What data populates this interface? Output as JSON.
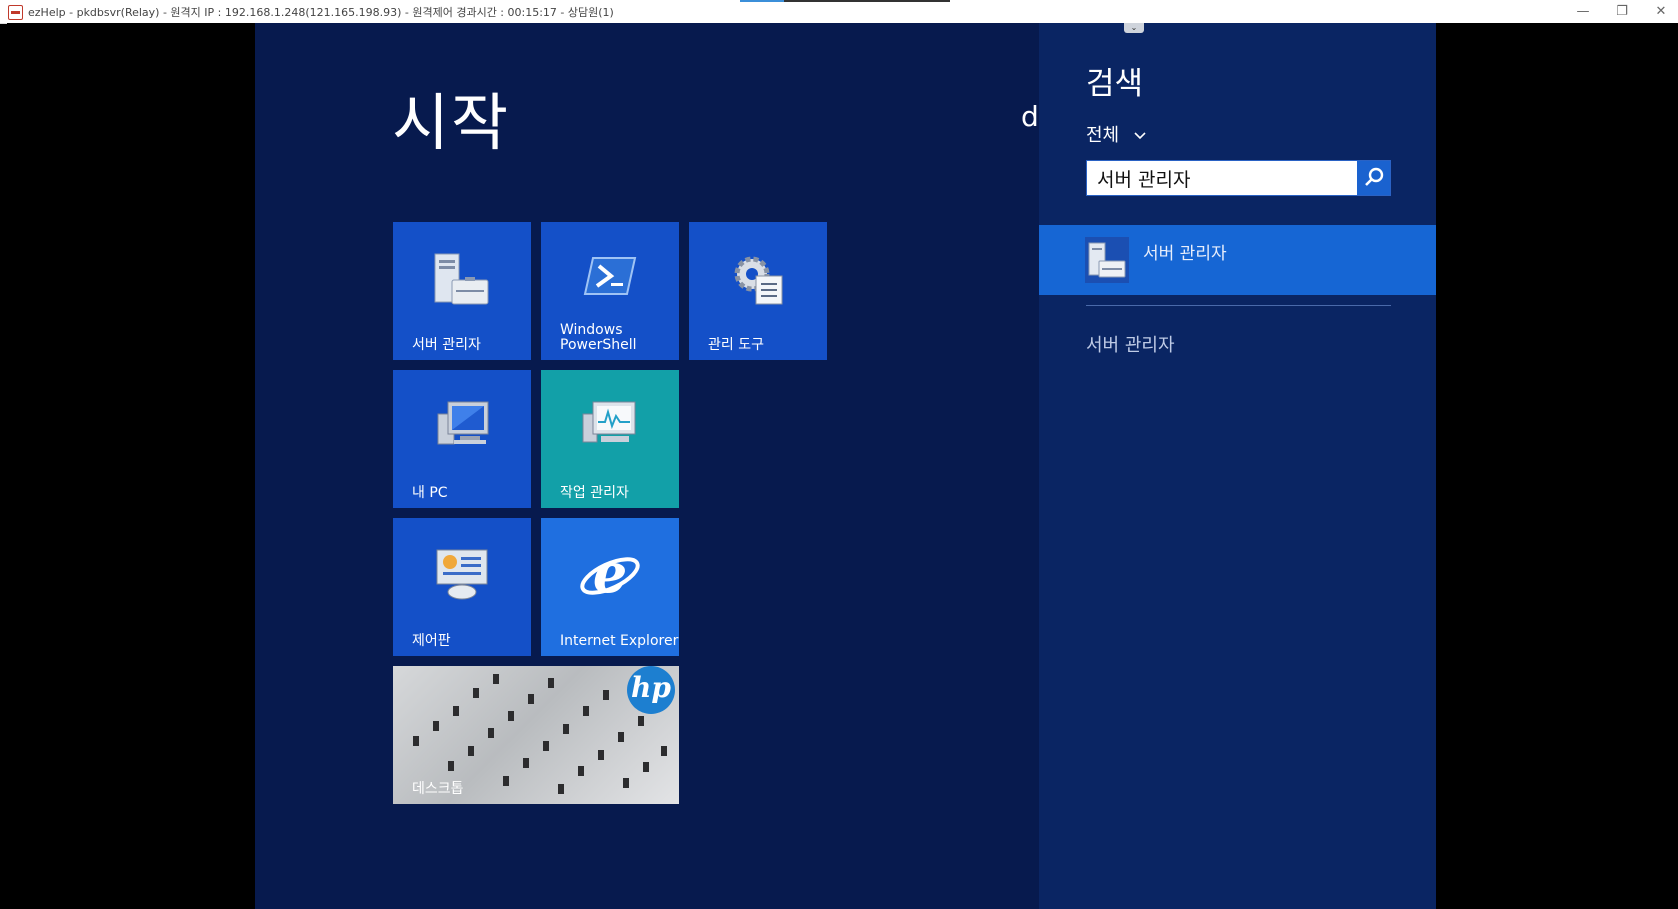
{
  "window": {
    "title": "ezHelp - pkdbsvr(Relay) - 원격지 IP : 192.168.1.248(121.165.198.93) - 원격제어 경과시간 : 00:15:17 - 상담원(1)",
    "controls": {
      "minimize": "—",
      "restore": "❐",
      "close": "✕"
    }
  },
  "start": {
    "title": "시작",
    "user_initial": "d",
    "tiles": [
      {
        "label": "서버 관리자",
        "icon": "server-manager-icon"
      },
      {
        "label": "Windows PowerShell",
        "icon": "powershell-icon"
      },
      {
        "label": "관리 도구",
        "icon": "admin-tools-icon"
      },
      {
        "label": "내 PC",
        "icon": "computer-icon"
      },
      {
        "label": "작업 관리자",
        "icon": "task-manager-icon"
      },
      {
        "label": "제어판",
        "icon": "control-panel-icon"
      },
      {
        "label": "Internet Explorer",
        "icon": "internet-explorer-icon"
      },
      {
        "label": "데스크톱",
        "icon": "desktop-icon"
      }
    ]
  },
  "search": {
    "heading": "검색",
    "scope": "전체",
    "query": "서버 관리자",
    "results": [
      {
        "label": "서버 관리자",
        "selected": true
      }
    ],
    "other_results": [
      {
        "label": "서버 관리자"
      }
    ]
  },
  "colors": {
    "start_background": "#071a4e",
    "search_pane": "#0a2563",
    "tile_blue": "#1450c8",
    "tile_teal": "#12a0a8",
    "selected_result": "#1666d4"
  }
}
